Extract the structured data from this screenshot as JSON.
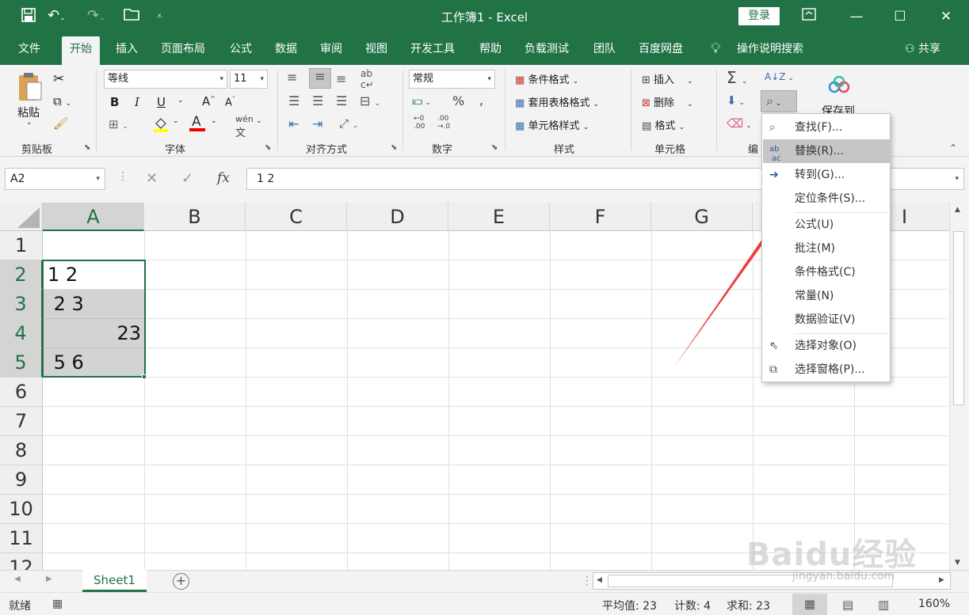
{
  "app": {
    "window_title": "工作簿1 - Excel",
    "login_label": "登录",
    "colors": {
      "brand": "#217346",
      "accent_arrow": "#e8413a",
      "selection": "#217346"
    }
  },
  "tabs": [
    "文件",
    "开始",
    "插入",
    "页面布局",
    "公式",
    "数据",
    "审阅",
    "视图",
    "开发工具",
    "帮助",
    "负载测试",
    "团队",
    "百度网盘"
  ],
  "active_tab": "开始",
  "tell_me": "操作说明搜索",
  "share": "共享",
  "ribbon": {
    "clipboard": {
      "paste": "粘贴",
      "label": "剪贴板"
    },
    "font": {
      "name": "等线",
      "size": "11",
      "bold": "B",
      "italic": "I",
      "underline": "U",
      "label": "字体"
    },
    "alignment": {
      "label": "对齐方式"
    },
    "number": {
      "format": "常规",
      "label": "数字"
    },
    "styles": {
      "conditional": "条件格式",
      "table": "套用表格格式",
      "cell": "单元格样式",
      "label": "样式"
    },
    "cells": {
      "insert": "插入",
      "delete": "删除",
      "format": "格式",
      "label": "单元格"
    },
    "editing": {
      "label": "编"
    },
    "save": {
      "label": "保存到"
    }
  },
  "formula_bar": {
    "name_box": "A2",
    "fx": "fx",
    "value": "1 2"
  },
  "grid": {
    "columns": [
      "A",
      "B",
      "C",
      "D",
      "E",
      "F",
      "G",
      "H",
      "I"
    ],
    "rows": [
      "1",
      "2",
      "3",
      "4",
      "5",
      "6",
      "7",
      "8",
      "9",
      "10",
      "11",
      "12"
    ],
    "cells": [
      {
        "ref": "A2",
        "value": "1 2"
      },
      {
        "ref": "A3",
        "value": " 2 3"
      },
      {
        "ref": "A4",
        "value": "23"
      },
      {
        "ref": "A5",
        "value": " 5 6"
      }
    ]
  },
  "menu": {
    "items": [
      {
        "label": "查找(F)...",
        "icon": "search-icon"
      },
      {
        "label": "替换(R)...",
        "icon": "replace-icon",
        "highlighted": true
      },
      {
        "label": "转到(G)...",
        "icon": "arrow-right-icon"
      },
      {
        "label": "定位条件(S)...",
        "icon": ""
      },
      {
        "label": "公式(U)",
        "icon": ""
      },
      {
        "label": "批注(M)",
        "icon": ""
      },
      {
        "label": "条件格式(C)",
        "icon": ""
      },
      {
        "label": "常量(N)",
        "icon": ""
      },
      {
        "label": "数据验证(V)",
        "icon": ""
      },
      {
        "label": "选择对象(O)",
        "icon": "cursor-icon"
      },
      {
        "label": "选择窗格(P)...",
        "icon": "pane-icon"
      }
    ]
  },
  "sheet_tab": "Sheet1",
  "status": {
    "mode": "就绪",
    "average": "平均值: 23",
    "count": "计数: 4",
    "sum": "求和: 23",
    "zoom": "160%"
  },
  "watermark": {
    "main": "Baidu经验",
    "sub": "jingyan.baidu.com"
  }
}
